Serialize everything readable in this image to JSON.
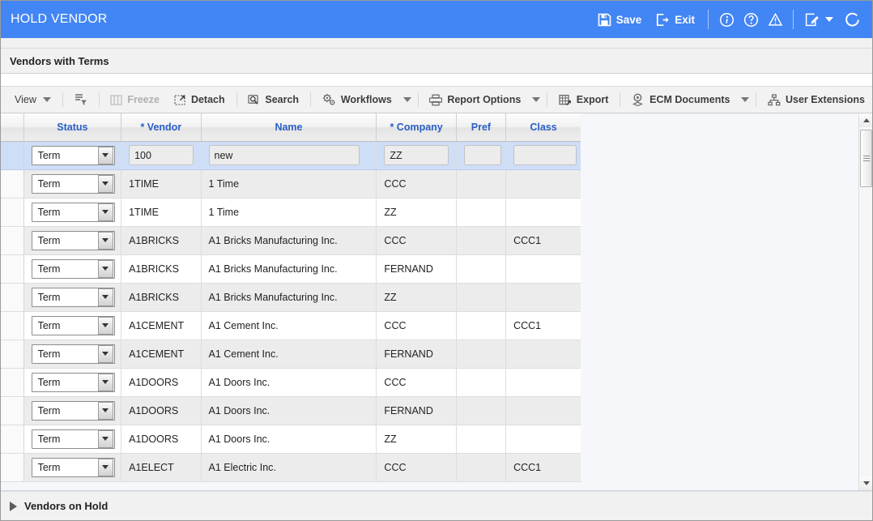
{
  "titlebar": {
    "title": "HOLD VENDOR",
    "save_label": "Save",
    "exit_label": "Exit",
    "icons": {
      "save": "save-floppy-icon",
      "exit": "exit-icon",
      "info": "info-circle-icon",
      "help": "help-circle-icon",
      "warning": "warning-triangle-icon",
      "notes": "edit-note-icon",
      "notes_caret": "chevron-down-icon",
      "refresh": "refresh-icon"
    },
    "accent_color": "#4285f4"
  },
  "section": {
    "title": "Vendors with Terms"
  },
  "toolbar": {
    "items": [
      {
        "label": "View",
        "icon": "",
        "caret": true,
        "disabled": false,
        "bold": false
      },
      {
        "label": "",
        "icon": "detach-filter-icon",
        "caret": false,
        "disabled": false,
        "bold": false
      },
      {
        "label": "Freeze",
        "icon": "freeze-columns-icon",
        "caret": false,
        "disabled": true,
        "bold": true
      },
      {
        "label": "Detach",
        "icon": "detach-window-icon",
        "caret": false,
        "disabled": false,
        "bold": true
      },
      {
        "label": "Search",
        "icon": "search-icon",
        "caret": false,
        "disabled": false,
        "bold": true
      },
      {
        "label": "Workflows",
        "icon": "gears-icon",
        "caret": true,
        "disabled": false,
        "bold": true
      },
      {
        "label": "Report Options",
        "icon": "printer-icon",
        "caret": true,
        "disabled": false,
        "bold": true
      },
      {
        "label": "Export",
        "icon": "export-grid-icon",
        "caret": false,
        "disabled": false,
        "bold": true
      },
      {
        "label": "ECM Documents",
        "icon": "ecm-documents-icon",
        "caret": true,
        "disabled": false,
        "bold": true
      },
      {
        "label": "User Extensions",
        "icon": "hierarchy-icon",
        "caret": false,
        "disabled": false,
        "bold": true
      }
    ]
  },
  "grid": {
    "columns": [
      {
        "key": "sel",
        "label": ""
      },
      {
        "key": "status",
        "label": "Status"
      },
      {
        "key": "vendor",
        "label": "* Vendor"
      },
      {
        "key": "name",
        "label": "Name"
      },
      {
        "key": "company",
        "label": "* Company"
      },
      {
        "key": "pref",
        "label": "Pref"
      },
      {
        "key": "class",
        "label": "Class"
      }
    ],
    "active_row_index": 0,
    "status_value": "Term",
    "rows": [
      {
        "status": "Term",
        "vendor": "100",
        "name": "new",
        "company": "ZZ",
        "pref": "",
        "class": "",
        "editing": true
      },
      {
        "status": "Term",
        "vendor": "1TIME",
        "name": "1 Time",
        "company": "CCC",
        "pref": "",
        "class": "",
        "editing": false
      },
      {
        "status": "Term",
        "vendor": "1TIME",
        "name": "1 Time",
        "company": "ZZ",
        "pref": "",
        "class": "",
        "editing": false
      },
      {
        "status": "Term",
        "vendor": "A1BRICKS",
        "name": "A1 Bricks Manufacturing Inc.",
        "company": "CCC",
        "pref": "",
        "class": "CCC1",
        "editing": false
      },
      {
        "status": "Term",
        "vendor": "A1BRICKS",
        "name": "A1 Bricks Manufacturing Inc.",
        "company": "FERNAND",
        "pref": "",
        "class": "",
        "editing": false
      },
      {
        "status": "Term",
        "vendor": "A1BRICKS",
        "name": "A1 Bricks Manufacturing Inc.",
        "company": "ZZ",
        "pref": "",
        "class": "",
        "editing": false
      },
      {
        "status": "Term",
        "vendor": "A1CEMENT",
        "name": "A1 Cement Inc.",
        "company": "CCC",
        "pref": "",
        "class": "CCC1",
        "editing": false
      },
      {
        "status": "Term",
        "vendor": "A1CEMENT",
        "name": "A1 Cement Inc.",
        "company": "FERNAND",
        "pref": "",
        "class": "",
        "editing": false
      },
      {
        "status": "Term",
        "vendor": "A1DOORS",
        "name": "A1 Doors Inc.",
        "company": "CCC",
        "pref": "",
        "class": "",
        "editing": false
      },
      {
        "status": "Term",
        "vendor": "A1DOORS",
        "name": "A1 Doors Inc.",
        "company": "FERNAND",
        "pref": "",
        "class": "",
        "editing": false
      },
      {
        "status": "Term",
        "vendor": "A1DOORS",
        "name": "A1 Doors Inc.",
        "company": "ZZ",
        "pref": "",
        "class": "",
        "editing": false
      },
      {
        "status": "Term",
        "vendor": "A1ELECT",
        "name": "A1 Electric Inc.",
        "company": "CCC",
        "pref": "",
        "class": "CCC1",
        "editing": false
      }
    ]
  },
  "footer": {
    "collapsed_section_title": "Vendors on Hold"
  }
}
